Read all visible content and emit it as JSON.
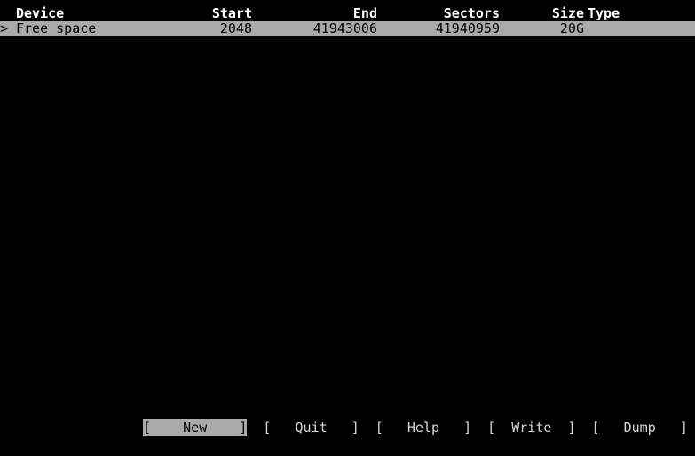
{
  "app": {
    "name": "cfdisk",
    "background_color": "#000000",
    "foreground_color": "#d8d8d8",
    "highlight_background_color": "#aaaaaa",
    "highlight_foreground_color": "#000000",
    "header_color": "#ffffff"
  },
  "table": {
    "columns": [
      {
        "key": "device",
        "label": "Device"
      },
      {
        "key": "start",
        "label": "Start"
      },
      {
        "key": "end",
        "label": "End"
      },
      {
        "key": "sectors",
        "label": "Sectors"
      },
      {
        "key": "size",
        "label": "Size"
      },
      {
        "key": "type",
        "label": "Type"
      }
    ],
    "rows": [
      {
        "marker": ">",
        "device": "Free space",
        "start": "2048",
        "end": "41943006",
        "sectors": "41940959",
        "size": "20G",
        "type": "",
        "selected": true
      }
    ]
  },
  "menu": {
    "items": [
      {
        "id": "new",
        "bracket_open": "[",
        "label": "New",
        "bracket_close": "]",
        "selected": true,
        "text": "[    New    ]"
      },
      {
        "id": "quit",
        "bracket_open": "[",
        "label": "Quit",
        "bracket_close": "]",
        "selected": false,
        "text": "[   Quit   ]"
      },
      {
        "id": "help",
        "bracket_open": "[",
        "label": "Help",
        "bracket_close": "]",
        "selected": false,
        "text": "[   Help   ]"
      },
      {
        "id": "write",
        "bracket_open": "[",
        "label": "Write",
        "bracket_close": "]",
        "selected": false,
        "text": "[  Write  ]"
      },
      {
        "id": "dump",
        "bracket_open": "[",
        "label": "Dump",
        "bracket_close": "]",
        "selected": false,
        "text": "[   Dump   ]"
      }
    ]
  }
}
